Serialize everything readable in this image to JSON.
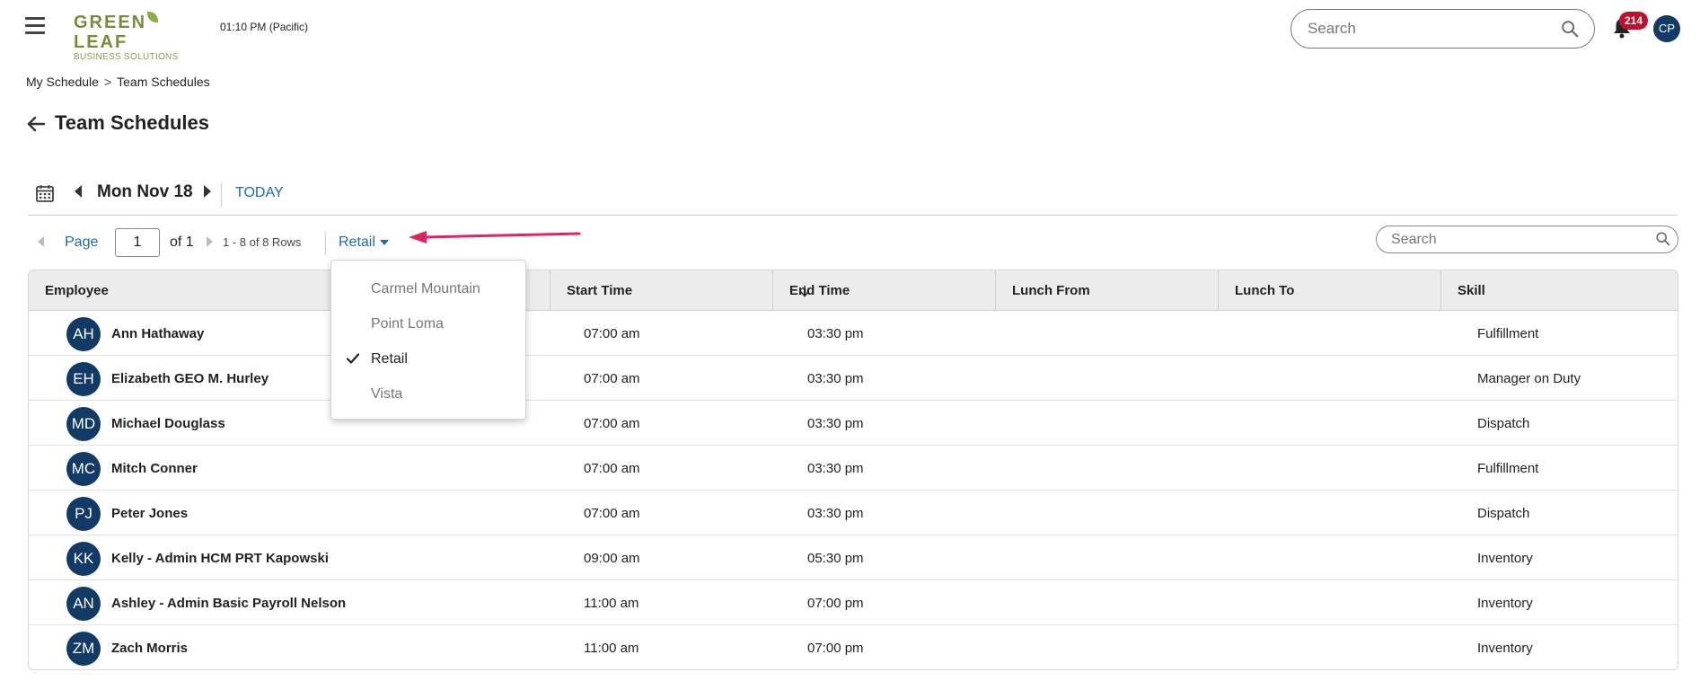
{
  "header": {
    "logo_line1_a": "GREEN",
    "logo_line1_b": "LEAF",
    "logo_line2": "BUSINESS SOLUTIONS",
    "time": "01:10 PM (Pacific)",
    "search_placeholder": "Search",
    "notification_count": "214",
    "user_initials": "CP"
  },
  "breadcrumb": {
    "items": [
      "My Schedule",
      "Team Schedules"
    ],
    "separator": ">"
  },
  "page": {
    "title": "Team Schedules"
  },
  "datebar": {
    "date": "Mon Nov 18",
    "today_label": "TODAY"
  },
  "paging": {
    "page_label": "Page",
    "page_value": "1",
    "of_label": "of 1",
    "rows_label": "1 - 8 of 8 Rows",
    "location": "Retail",
    "search_placeholder": "Search"
  },
  "location_dropdown": {
    "options": [
      "Carmel Mountain",
      "Point Loma",
      "Retail",
      "Vista"
    ],
    "selected": "Retail"
  },
  "table": {
    "columns": [
      "Employee",
      "Start Time",
      "End Time",
      "Lunch From",
      "Lunch To",
      "Skill"
    ],
    "rows": [
      {
        "initials": "AH",
        "name": "Ann Hathaway",
        "start": "07:00 am",
        "end": "03:30 pm",
        "lunch_from": "",
        "lunch_to": "",
        "skill": "Fulfillment"
      },
      {
        "initials": "EH",
        "name": "Elizabeth GEO M. Hurley",
        "start": "07:00 am",
        "end": "03:30 pm",
        "lunch_from": "",
        "lunch_to": "",
        "skill": "Manager on Duty"
      },
      {
        "initials": "MD",
        "name": "Michael Douglass",
        "start": "07:00 am",
        "end": "03:30 pm",
        "lunch_from": "",
        "lunch_to": "",
        "skill": "Dispatch"
      },
      {
        "initials": "MC",
        "name": "Mitch Conner",
        "start": "07:00 am",
        "end": "03:30 pm",
        "lunch_from": "",
        "lunch_to": "",
        "skill": "Fulfillment"
      },
      {
        "initials": "PJ",
        "name": "Peter Jones",
        "start": "07:00 am",
        "end": "03:30 pm",
        "lunch_from": "",
        "lunch_to": "",
        "skill": "Dispatch"
      },
      {
        "initials": "KK",
        "name": "Kelly - Admin HCM PRT Kapowski",
        "start": "09:00 am",
        "end": "05:30 pm",
        "lunch_from": "",
        "lunch_to": "",
        "skill": "Inventory"
      },
      {
        "initials": "AN",
        "name": "Ashley - Admin Basic Payroll Nelson",
        "start": "11:00 am",
        "end": "07:00 pm",
        "lunch_from": "",
        "lunch_to": "",
        "skill": "Inventory"
      },
      {
        "initials": "ZM",
        "name": "Zach Morris",
        "start": "11:00 am",
        "end": "07:00 pm",
        "lunch_from": "",
        "lunch_to": "",
        "skill": "Inventory"
      }
    ]
  },
  "colors": {
    "brand_green": "#7a8c3a",
    "link_blue": "#1a6bb0",
    "avatar_navy": "#123a66",
    "badge_red": "#c0102e",
    "annotation_arrow": "#e0245e"
  }
}
